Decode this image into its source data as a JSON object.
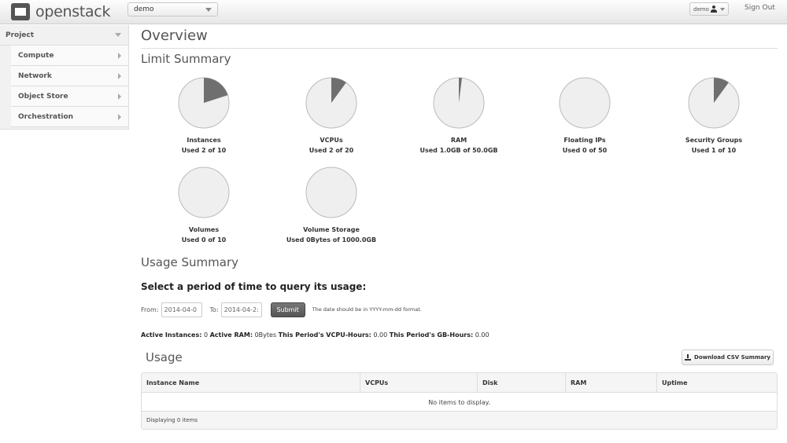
{
  "header": {
    "brand": "openstack",
    "project_select": "demo",
    "user_menu": "demo",
    "sign_out": "Sign Out"
  },
  "sidebar": {
    "section": "Project",
    "items": [
      {
        "label": "Compute"
      },
      {
        "label": "Network"
      },
      {
        "label": "Object Store"
      },
      {
        "label": "Orchestration"
      }
    ]
  },
  "main": {
    "title": "Overview",
    "limit_summary_title": "Limit Summary",
    "limits": [
      {
        "name": "Instances",
        "used_text": "Used 2 of 10",
        "fraction": 0.2
      },
      {
        "name": "VCPUs",
        "used_text": "Used 2 of 20",
        "fraction": 0.1
      },
      {
        "name": "RAM",
        "used_text": "Used 1.0GB of 50.0GB",
        "fraction": 0.02
      },
      {
        "name": "Floating IPs",
        "used_text": "Used 0 of 50",
        "fraction": 0
      },
      {
        "name": "Security Groups",
        "used_text": "Used 1 of 10",
        "fraction": 0.1
      },
      {
        "name": "Volumes",
        "used_text": "Used 0 of 10",
        "fraction": 0
      },
      {
        "name": "Volume Storage",
        "used_text": "Used 0Bytes of 1000.0GB",
        "fraction": 0
      }
    ],
    "usage_summary_title": "Usage Summary",
    "query_title": "Select a period of time to query its usage:",
    "form": {
      "from_label": "From:",
      "from_value": "2014-04-0",
      "to_label": "To:",
      "to_value": "2014-04-2:",
      "submit": "Submit",
      "hint": "The date should be in YYYY-mm-dd format."
    },
    "stats": {
      "active_instances_label": "Active Instances:",
      "active_instances": "0",
      "active_ram_label": "Active RAM:",
      "active_ram": "0Bytes",
      "vcpu_hours_label": "This Period's VCPU-Hours:",
      "vcpu_hours": "0.00",
      "gb_hours_label": "This Period's GB-Hours:",
      "gb_hours": "0.00"
    },
    "usage_title": "Usage",
    "csv_button": "Download CSV Summary",
    "table": {
      "columns": [
        "Instance Name",
        "VCPUs",
        "Disk",
        "RAM",
        "Uptime"
      ],
      "empty_text": "No items to display.",
      "footer": "Displaying 0 items"
    }
  },
  "colors": {
    "pie_used": "#6f6f6f",
    "pie_free": "#efefef"
  }
}
